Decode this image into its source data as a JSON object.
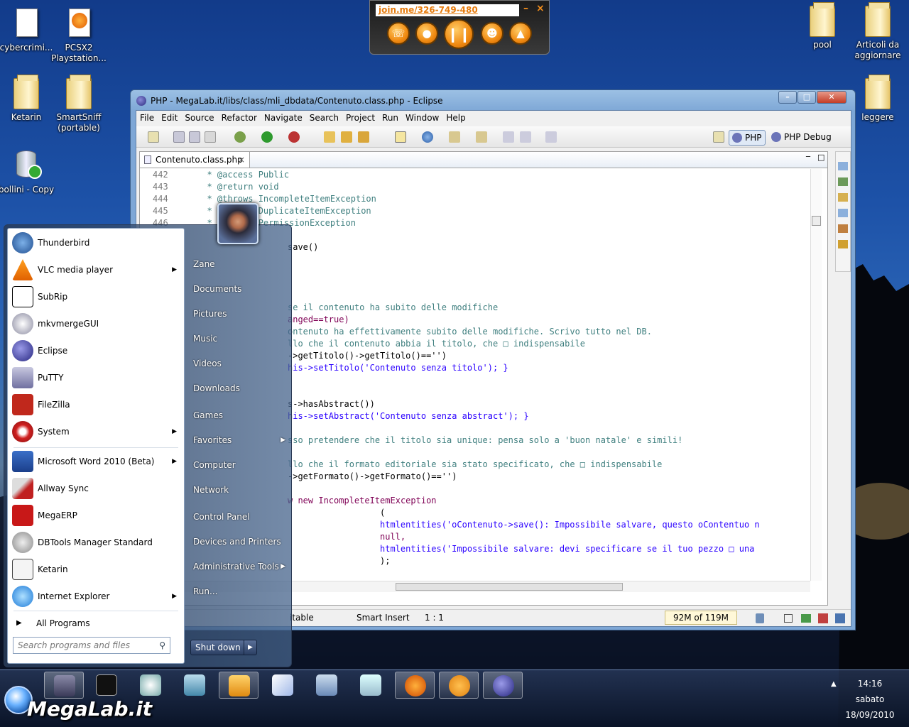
{
  "desktop": {
    "icons": [
      {
        "label": "cybercrimi..."
      },
      {
        "label": "PCSX2 Playstation..."
      },
      {
        "label": "Ketarin"
      },
      {
        "label": "SmartSniff (portable)"
      },
      {
        "label": "bollini - Copy"
      },
      {
        "label": "pool"
      },
      {
        "label": "Articoli da aggiornare"
      },
      {
        "label": "leggere"
      }
    ]
  },
  "joinme": {
    "url": "join.me/326-749-480",
    "minimize": "–",
    "close": "×"
  },
  "eclipse": {
    "title": "PHP - MegaLab.it/libs/class/mli_dbdata/Contenuto.class.php - Eclipse",
    "menu": [
      "File",
      "Edit",
      "Source",
      "Refactor",
      "Navigate",
      "Search",
      "Project",
      "Run",
      "Window",
      "Help"
    ],
    "perspectives": {
      "php": "PHP",
      "php_debug": "PHP Debug"
    },
    "tab": {
      "label": "Contenuto.class.php"
    },
    "line_numbers": [
      "442",
      "443",
      "444",
      "445",
      "446"
    ],
    "code": [
      {
        "text": "  * @access Public"
      },
      {
        "text": "  * @return void"
      },
      {
        "text": "  * @throws IncompleteItemException"
      },
      {
        "text": "  *         DuplicateItemException"
      },
      {
        "text": "  *         PermissionException"
      },
      {
        "text": "save()"
      },
      {
        "text": "se il contenuto ha subito delle modifiche"
      },
      {
        "text": "anged==true)"
      },
      {
        "text": "ontenuto ha effettivamente subito delle modifiche. Scrivo tutto nel DB."
      },
      {
        "text": "llo che il contenuto abbia il titolo, che □ indispensabile"
      },
      {
        "text": "->getTitolo()->getTitolo()=='')"
      },
      {
        "text": "his->setTitolo('Contenuto senza titolo'); }"
      },
      {
        "text": "s->hasAbstract())"
      },
      {
        "text": "his->setAbstract('Contenuto senza abstract'); }"
      },
      {
        "text": "sso pretendere che il titolo sia unique: pensa solo a 'buon natale' e simili!"
      },
      {
        "text": "llo che il formato editoriale sia stato specificato, che □ indispensabile"
      },
      {
        "text": "->getFormato()->getFormato()=='')"
      },
      {
        "text": "w new IncompleteItemException"
      },
      {
        "text": "("
      },
      {
        "text": "htmlentities('oContenuto->save(): Impossibile salvare, questo oContentuo n"
      },
      {
        "text": "null,"
      },
      {
        "text": "htmlentities('Impossibile salvare: devi specificare se il tuo pezzo □ una"
      },
      {
        "text": ");"
      }
    ],
    "status": {
      "writable": "itable",
      "insert_mode": "Smart Insert",
      "position": "1 : 1",
      "memory": "92M of 119M"
    }
  },
  "startmenu": {
    "user": "Zane",
    "programs": [
      {
        "label": "Thunderbird",
        "submenu": false
      },
      {
        "label": "VLC media player",
        "submenu": true
      },
      {
        "label": "SubRip",
        "submenu": false
      },
      {
        "label": "mkvmergeGUI",
        "submenu": false
      },
      {
        "label": "Eclipse",
        "submenu": false
      },
      {
        "label": "PuTTY",
        "submenu": false
      },
      {
        "label": "FileZilla",
        "submenu": false
      },
      {
        "label": "System",
        "submenu": true
      },
      {
        "label": "Microsoft Word 2010 (Beta)",
        "submenu": true
      },
      {
        "label": "Allway Sync",
        "submenu": false
      },
      {
        "label": "MegaERP",
        "submenu": false
      },
      {
        "label": "DBTools Manager Standard",
        "submenu": false
      },
      {
        "label": "Ketarin",
        "submenu": false
      },
      {
        "label": "Internet Explorer",
        "submenu": true
      }
    ],
    "all_programs": "All Programs",
    "search_placeholder": "Search programs and files",
    "right": [
      {
        "label": "Zane"
      },
      {
        "label": "Documents"
      },
      {
        "label": "Pictures"
      },
      {
        "label": "Music"
      },
      {
        "label": "Videos"
      },
      {
        "label": "Downloads"
      },
      {
        "label": "Games"
      },
      {
        "label": "Favorites"
      },
      {
        "label": "Computer"
      },
      {
        "label": "Network"
      },
      {
        "label": "Control Panel"
      },
      {
        "label": "Devices and Printers"
      },
      {
        "label": "Administrative Tools"
      },
      {
        "label": "Run..."
      }
    ],
    "shutdown": "Shut down"
  },
  "taskbar": {
    "clock": {
      "time": "14:16",
      "day": "sabato",
      "date": "18/09/2010"
    },
    "brand": "MegaLab.it"
  }
}
